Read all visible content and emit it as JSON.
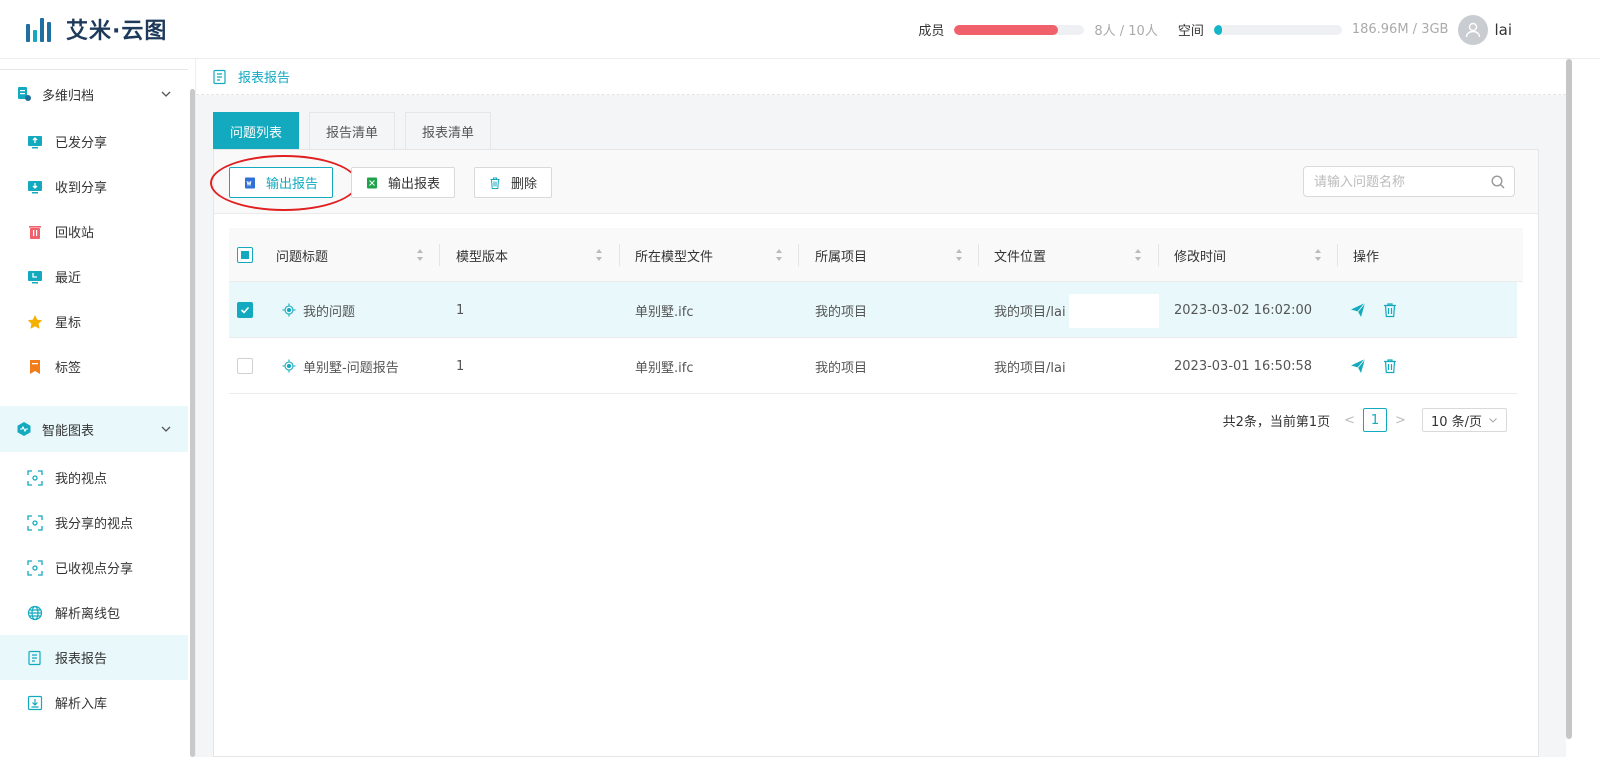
{
  "app": {
    "name": "艾米·云图"
  },
  "header": {
    "members_label": "成员",
    "members_usage": "8人 / 10人",
    "members_fraction": 0.8,
    "members_color": "#f0616b",
    "space_label": "空间",
    "space_usage": "186.96M / 3GB",
    "space_fraction": 0.06,
    "space_color": "#13b5c9",
    "username": "lai"
  },
  "sidebar": {
    "groups": [
      {
        "label": "多维归档",
        "icon": "archive-icon"
      },
      {
        "label": "智能图表",
        "icon": "chart-icon"
      }
    ],
    "items": [
      {
        "label": "已发分享",
        "icon": "share-sent-icon"
      },
      {
        "label": "收到分享",
        "icon": "share-received-icon"
      },
      {
        "label": "回收站",
        "icon": "trash-icon"
      },
      {
        "label": "最近",
        "icon": "recent-icon"
      },
      {
        "label": "星标",
        "icon": "star-icon"
      },
      {
        "label": "标签",
        "icon": "bookmark-icon"
      },
      {
        "label": "我的视点",
        "icon": "viewpoint-icon"
      },
      {
        "label": "我分享的视点",
        "icon": "viewpoint-icon"
      },
      {
        "label": "已收视点分享",
        "icon": "viewpoint-icon"
      },
      {
        "label": "解析离线包",
        "icon": "globe-icon"
      },
      {
        "label": "报表报告",
        "icon": "report-icon"
      },
      {
        "label": "解析入库",
        "icon": "import-icon"
      }
    ],
    "active_item": "报表报告"
  },
  "breadcrumb": {
    "label": "报表报告"
  },
  "tabs": [
    {
      "label": "问题列表"
    },
    {
      "label": "报告清单"
    },
    {
      "label": "报表清单"
    }
  ],
  "toolbar": {
    "export_report_label": "输出报告",
    "export_sheet_label": "输出报表",
    "delete_label": "删除",
    "search_placeholder": "请输入问题名称"
  },
  "table": {
    "columns": [
      "问题标题",
      "模型版本",
      "所在模型文件",
      "所属项目",
      "文件位置",
      "修改时间",
      "操作"
    ],
    "rows": [
      {
        "title": "我的问题",
        "version": "1",
        "model_file": "单别墅.ifc",
        "project": "我的项目",
        "location": "我的项目/lai",
        "modified": "2023-03-02 16:02:00",
        "selected": true
      },
      {
        "title": "单别墅-问题报告",
        "version": "1",
        "model_file": "单别墅.ifc",
        "project": "我的项目",
        "location": "我的项目/lai",
        "modified": "2023-03-01 16:50:58",
        "selected": false
      }
    ]
  },
  "pagination": {
    "summary": "共2条，当前第1页",
    "current_page": "1",
    "page_size": "10 条/页",
    "prev": "<",
    "next": ">"
  },
  "colors": {
    "accent": "#13a9bf",
    "active_bg": "#e8f8fb",
    "danger_ring": "#e02020"
  }
}
